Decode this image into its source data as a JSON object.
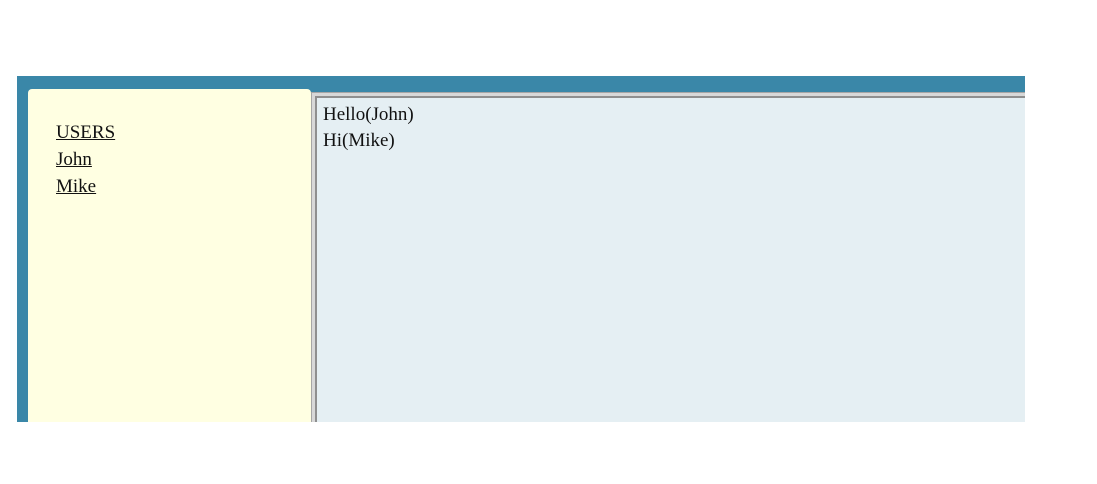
{
  "sidebar": {
    "header": "USERS",
    "users": [
      "John",
      "Mike"
    ]
  },
  "messages": [
    {
      "text": "Hello(John)"
    },
    {
      "text": "Hi(Mike)"
    }
  ],
  "colors": {
    "frame": "#3a87a8",
    "sidebar_bg": "#ffffe2",
    "message_bg": "#e5eff3"
  }
}
